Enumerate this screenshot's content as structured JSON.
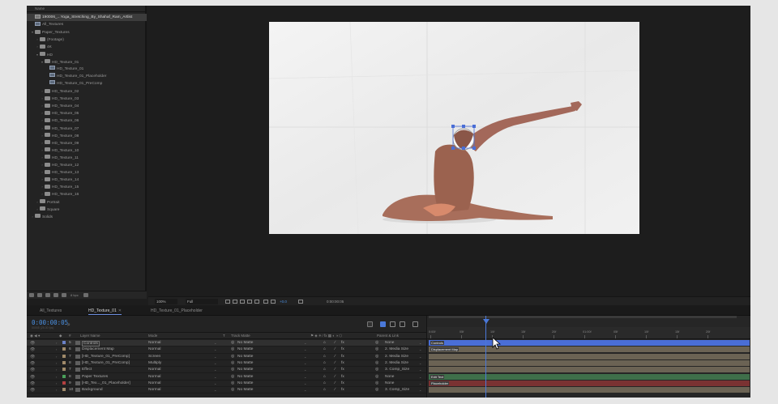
{
  "project": {
    "column_header": "Name",
    "items": [
      {
        "label": "190006_...Yoga_Stretching_By_Shahaf_Ram_Artlist",
        "type": "file",
        "depth": 0,
        "twirl": "",
        "selected": true
      },
      {
        "label": "All_Textures",
        "type": "comp",
        "depth": 0,
        "twirl": ""
      },
      {
        "label": "Paper_Textures",
        "type": "folder",
        "depth": 0,
        "twirl": "▾"
      },
      {
        "label": "(Footage)",
        "type": "folder",
        "depth": 1,
        "twirl": "›"
      },
      {
        "label": "4K",
        "type": "folder",
        "depth": 1,
        "twirl": "›"
      },
      {
        "label": "HD",
        "type": "folder",
        "depth": 1,
        "twirl": "▾"
      },
      {
        "label": "HD_Texture_01",
        "type": "folder",
        "depth": 2,
        "twirl": "▾"
      },
      {
        "label": "HD_Texture_01",
        "type": "comp",
        "depth": 3,
        "twirl": ""
      },
      {
        "label": "HD_Texture_01_Placeholder",
        "type": "comp",
        "depth": 3,
        "twirl": ""
      },
      {
        "label": "HD_Texture_01_PreComp",
        "type": "comp",
        "depth": 3,
        "twirl": ""
      },
      {
        "label": "HD_Texture_02",
        "type": "folder",
        "depth": 2,
        "twirl": "›"
      },
      {
        "label": "HD_Texture_03",
        "type": "folder",
        "depth": 2,
        "twirl": "›"
      },
      {
        "label": "HD_Texture_04",
        "type": "folder",
        "depth": 2,
        "twirl": "›"
      },
      {
        "label": "HD_Texture_05",
        "type": "folder",
        "depth": 2,
        "twirl": "›"
      },
      {
        "label": "HD_Texture_06",
        "type": "folder",
        "depth": 2,
        "twirl": "›"
      },
      {
        "label": "HD_Texture_07",
        "type": "folder",
        "depth": 2,
        "twirl": "›"
      },
      {
        "label": "HD_Texture_08",
        "type": "folder",
        "depth": 2,
        "twirl": "›"
      },
      {
        "label": "HD_Texture_09",
        "type": "folder",
        "depth": 2,
        "twirl": "›"
      },
      {
        "label": "HD_Texture_10",
        "type": "folder",
        "depth": 2,
        "twirl": "›"
      },
      {
        "label": "HD_Texture_11",
        "type": "folder",
        "depth": 2,
        "twirl": "›"
      },
      {
        "label": "HD_Texture_12",
        "type": "folder",
        "depth": 2,
        "twirl": "›"
      },
      {
        "label": "HD_Texture_13",
        "type": "folder",
        "depth": 2,
        "twirl": "›"
      },
      {
        "label": "HD_Texture_14",
        "type": "folder",
        "depth": 2,
        "twirl": "›"
      },
      {
        "label": "HD_Texture_15",
        "type": "folder",
        "depth": 2,
        "twirl": "›"
      },
      {
        "label": "HD_Texture_16",
        "type": "folder",
        "depth": 2,
        "twirl": "›"
      },
      {
        "label": "Portrait",
        "type": "folder",
        "depth": 1,
        "twirl": "›"
      },
      {
        "label": "Square",
        "type": "folder",
        "depth": 1,
        "twirl": "›"
      },
      {
        "label": "Solids",
        "type": "folder",
        "depth": 0,
        "twirl": "›"
      }
    ],
    "bpc": "8 bpc"
  },
  "viewer": {
    "zoom": "100%",
    "resolution": "Full",
    "exposure": "+0.0",
    "timecode": "0:00:00:05"
  },
  "timeline": {
    "tabs": [
      {
        "label": "All_Textures",
        "active": false
      },
      {
        "label": "HD_Texture_01",
        "active": true
      },
      {
        "label": "HD_Texture_01_Placeholder",
        "active": false
      }
    ],
    "current_time": "0:00:00:05",
    "fps_info": "00005 (25.00 fps)",
    "columns": {
      "layer_name": "Layer Name",
      "mode": "Mode",
      "t": "T",
      "track_matte": "Track Matte",
      "parent": "Parent & Link"
    },
    "layers": [
      {
        "num": "5",
        "name": "Controls",
        "mode": "Normal",
        "matte": "No Matte",
        "parent": "None",
        "color": "#6b82c7",
        "bar": "#4a6ed6",
        "selected": true,
        "eye": "👁"
      },
      {
        "num": "6",
        "name": "Displacement Map",
        "mode": "Normal",
        "matte": "No Matte",
        "parent": "2. Media Size",
        "color": "#a08a6a",
        "bar": "#6b6354",
        "selected": false,
        "eye": "👁"
      },
      {
        "num": "7",
        "name": "[HD_Texture_01_PreComp]",
        "mode": "Screen",
        "matte": "No Matte",
        "parent": "2. Media Size",
        "color": "#a08a6a",
        "bar": "#6b6354",
        "selected": false,
        "eye": "👁"
      },
      {
        "num": "8",
        "name": "[HD_Texture_01_PreComp]",
        "mode": "Multiply",
        "matte": "No Matte",
        "parent": "2. Media Size",
        "color": "#a08a6a",
        "bar": "#6b6354",
        "selected": false,
        "eye": "👁"
      },
      {
        "num": "7",
        "name": "Effect",
        "mode": "Normal",
        "matte": "No Matte",
        "parent": "3. Comp_Size",
        "color": "#a08a6a",
        "bar": "#6b6354",
        "selected": false,
        "eye": "👁"
      },
      {
        "num": "8",
        "name": "Paper Textures",
        "mode": "Normal",
        "matte": "No Matte",
        "parent": "None",
        "color": "#4aa05a",
        "bar": "#3f6f4a",
        "selected": false,
        "eye": "👁"
      },
      {
        "num": "9",
        "name": "[HD_Tex..._01_Placeholder]",
        "mode": "Normal",
        "matte": "No Matte",
        "parent": "None",
        "color": "#b44040",
        "bar": "#7a3232",
        "selected": false,
        "eye": "👁"
      },
      {
        "num": "10",
        "name": "Background",
        "mode": "Normal",
        "matte": "No Matte",
        "parent": "3. Comp_Size",
        "color": "#a08a6a",
        "bar": "#6b6354",
        "selected": false,
        "eye": "👁"
      }
    ],
    "bar_labels": [
      "Controls",
      "Displacement Map",
      "",
      "",
      "",
      "Edit Text",
      "Placeholder",
      ""
    ],
    "ruler": [
      "0:00f",
      "05f",
      "10f",
      "15f",
      "20f",
      "01:00f",
      "05f",
      "10f",
      "15f",
      "20f"
    ]
  }
}
